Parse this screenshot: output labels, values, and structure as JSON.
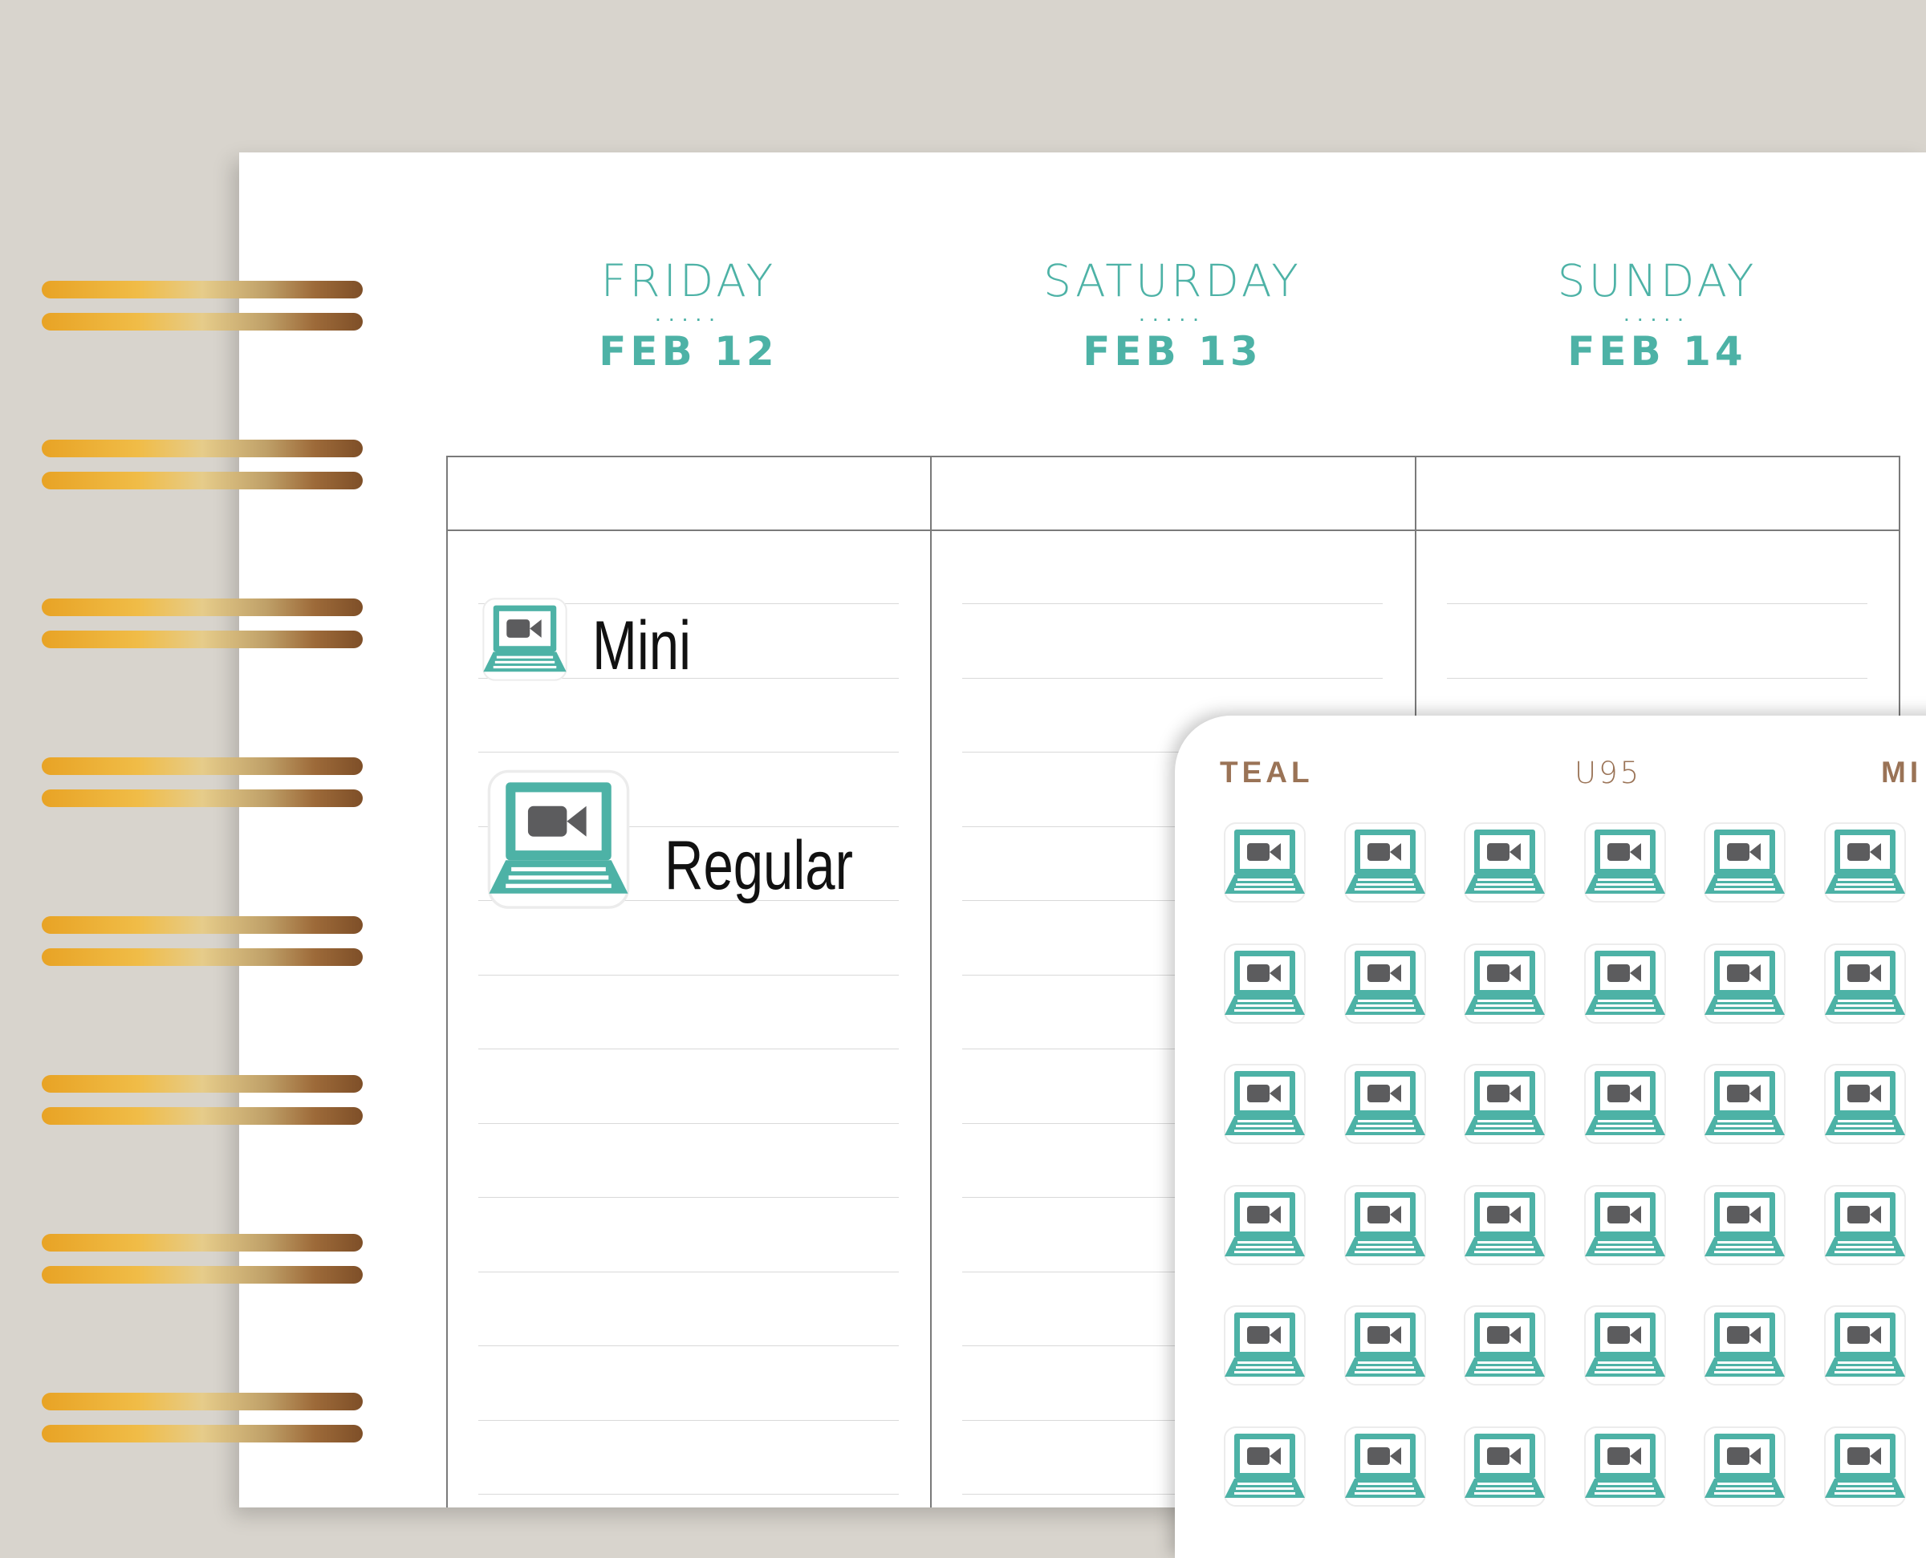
{
  "planner": {
    "days": [
      {
        "name": "FRIDAY",
        "dots": ".....",
        "date": "FEB 12"
      },
      {
        "name": "SATURDAY",
        "dots": ".....",
        "date": "FEB 13"
      },
      {
        "name": "SUNDAY",
        "dots": ".....",
        "date": "FEB 14"
      }
    ],
    "samples": {
      "mini_label": "Mini",
      "regular_label": "Regular"
    }
  },
  "sticker_sheet": {
    "color_label": "TEAL",
    "code": "U95",
    "size_label": "MI",
    "icon": "laptop-video-call-icon",
    "rows": 6,
    "cols": 6
  },
  "colors": {
    "teal": "#4db2a6",
    "dark_gray": "#5c5c5e",
    "brown": "#9a7356",
    "background": "#d8d4cd"
  }
}
